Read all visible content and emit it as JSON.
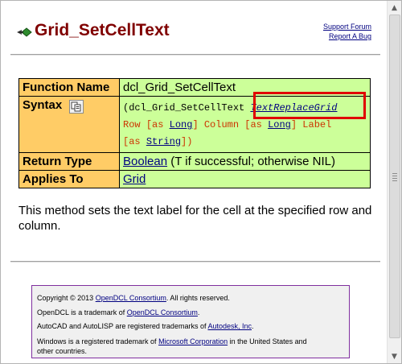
{
  "header": {
    "title": "Grid_SetCellText",
    "icon": "green-diamond-arrow-icon",
    "links": [
      "Support Forum",
      "Report A Bug"
    ]
  },
  "function_table": {
    "function_name_label": "Function Name",
    "function_name_value": "dcl_Grid_SetCellText",
    "syntax_label": "Syntax",
    "syntax": {
      "open": "(dcl_Grid_SetCellText ",
      "arg1": "TextReplaceGrid",
      "row": "Row",
      "as1": "[as ",
      "type1": "Long",
      "close1": "]",
      "column": "Column",
      "as2": "[as ",
      "type2": "Long",
      "close2": "]",
      "label": "Label",
      "as3": "[as ",
      "type3": "String",
      "close3": "])"
    },
    "return_type_label": "Return Type",
    "return_type_link": "Boolean",
    "return_type_note": " (T if successful; otherwise NIL)",
    "applies_to_label": "Applies To",
    "applies_to_link": "Grid"
  },
  "description": "This method sets the text label for the cell at the specified row and column.",
  "footer": {
    "line1_prefix": "Copyright © 2013 ",
    "line1_link": "OpenDCL Consortium",
    "line1_suffix": ". All rights reserved.",
    "line2_prefix": "OpenDCL is a trademark of ",
    "line2_link": "OpenDCL Consortium",
    "line2_suffix": ".",
    "line3_prefix": "AutoCAD and AutoLISP are registered trademarks of ",
    "line3_link": "Autodesk, Inc",
    "line3_suffix": ".",
    "line4_prefix": "Windows is a registered trademark of ",
    "line4_link": "Microsoft Corporation",
    "line4_suffix": " in the United States and",
    "line5": "other countries."
  },
  "colors": {
    "title": "#800000",
    "label_cell": "#ffcc66",
    "value_cell": "#ccff99",
    "highlight": "#e00000",
    "link": "#000080"
  }
}
